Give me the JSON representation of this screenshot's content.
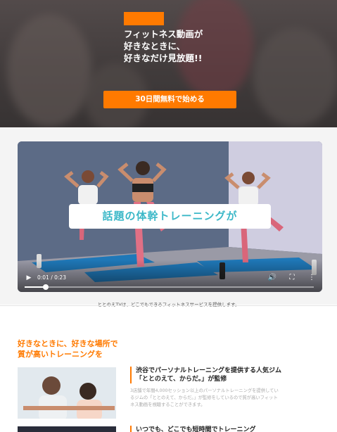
{
  "hero": {
    "headline": [
      "フィットネス動画が",
      "好きなときに、",
      "好きなだけ見放題!!"
    ],
    "cta_label": "30日間無料で始める"
  },
  "video": {
    "caption": "話題の体幹トレーニングが",
    "time": "0:01 / 0:23",
    "progress": 0.072,
    "play_icon": "play-icon",
    "volume_icon": "volume-icon",
    "fullscreen_icon": "fullscreen-icon",
    "more_icon": "more-vertical-icon"
  },
  "band_note": "ととのえTVは、どこでもできるフィットネスサービスを提供します。",
  "section": {
    "title": [
      "好きなときに、好きな場所で",
      "質が高いトレーニングを"
    ]
  },
  "cards": [
    {
      "title": [
        "渋谷でパーソナルトレーニングを提供する人気ジム",
        "「ととのえて、からだ。」が監修"
      ],
      "desc": [
        "3店舗で年間4,000セッション以上のパーソナルトレーニングを提供してい",
        "るジムの「ととのえて、からだ。」が監修をしているので質が高いフィット",
        "ネス動画を視聴することができます。"
      ]
    },
    {
      "title": [
        "いつでも、どこでも短時間でトレーニング"
      ]
    }
  ],
  "colors": {
    "accent": "#ff7a00",
    "caption_text": "#3cb8c8"
  }
}
